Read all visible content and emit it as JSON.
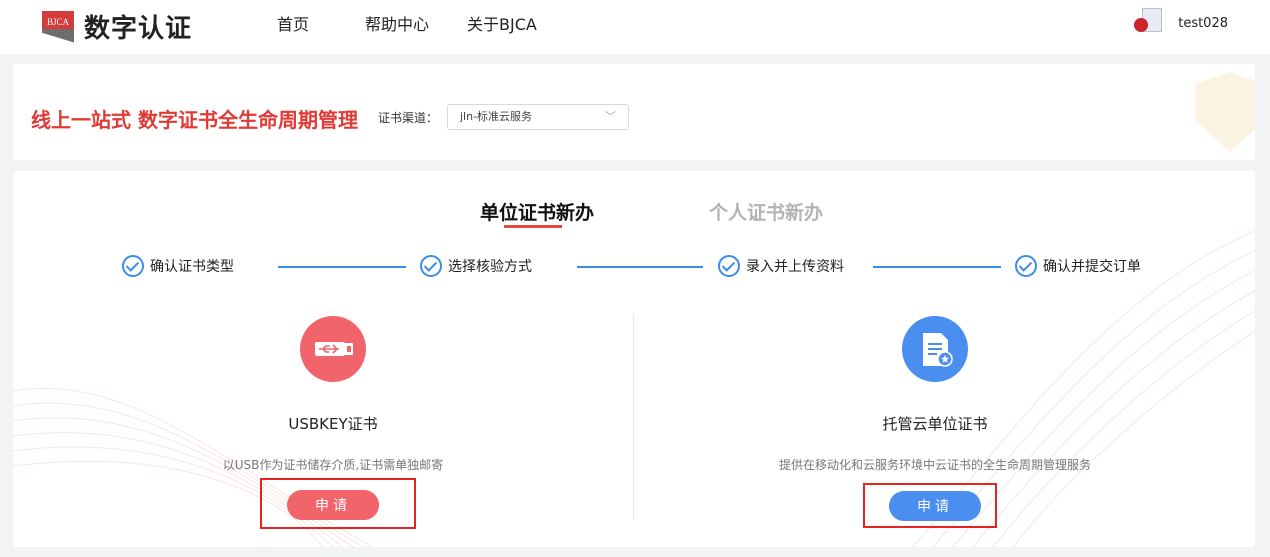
{
  "header": {
    "logo_badge": "BJCA",
    "logo_text": "数字认证",
    "nav": [
      "首页",
      "帮助中心",
      "关于BJCA"
    ],
    "username": "test028"
  },
  "banner": {
    "title": "线上一站式 数字证书全生命周期管理",
    "channel_label": "证书渠道：",
    "channel_value": "jln-标准云服务"
  },
  "tabs": {
    "active": "单位证书新办",
    "inactive": "个人证书新办"
  },
  "steps": [
    "确认证书类型",
    "选择核验方式",
    "录入并上传资料",
    "确认并提交订单"
  ],
  "products": [
    {
      "name": "USBKEY证书",
      "desc": "以USB作为证书储存介质,证书需单独邮寄",
      "button": "申请",
      "color": "#f2646b"
    },
    {
      "name": "托管云单位证书",
      "desc": "提供在移动化和云服务环境中云证书的全生命周期管理服务",
      "button": "申请",
      "color": "#4a8ef0"
    }
  ],
  "colors": {
    "brand_red": "#e03a36",
    "step_blue": "#3b8ee8",
    "highlight": "#e52520"
  },
  "icons": [
    "usb-key-icon",
    "document-certificate-icon",
    "check-circle-icon",
    "chevron-down-icon"
  ]
}
